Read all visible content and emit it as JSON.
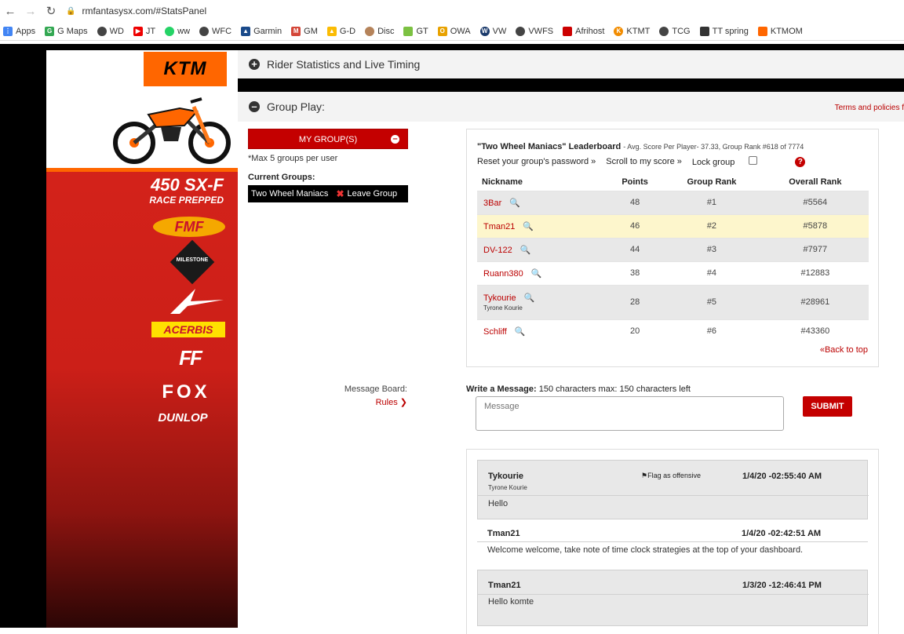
{
  "browser": {
    "url": "rmfantasysx.com/#StatsPanel",
    "bookmarks": [
      "Apps",
      "G Maps",
      "WD",
      "JT",
      "ww",
      "WFC",
      "Garmin",
      "GM",
      "G-D",
      "Disc",
      "GT",
      "OWA",
      "VW",
      "VWFS",
      "Afrihost",
      "KTMT",
      "TCG",
      "TT spring",
      "KTMOM"
    ]
  },
  "sidebar": {
    "brand": "KTM",
    "model": "450 SX-F",
    "model_sub": "RACE PREPPED",
    "sponsors": {
      "fmf": "FMF",
      "milestone": "MILESTONE",
      "acerbis": "ACERBIS",
      "fly": "FF",
      "fox": "FOX",
      "dunlop": "DUNLOP"
    }
  },
  "panels": {
    "rider_stats": "Rider Statistics and Live Timing",
    "group_play": "Group Play:",
    "terms": "Terms and policies f"
  },
  "groups": {
    "my_groups_label": "MY GROUP(S)",
    "max_note": "*Max 5 groups per user",
    "current_label": "Current Groups:",
    "current_group": "Two Wheel Maniacs",
    "leave_label": "Leave Group"
  },
  "leaderboard": {
    "title": "\"Two Wheel Maniacs\" Leaderboard",
    "subtitle": "- Avg. Score Per Player- 37.33, Group Rank #618 of 7774",
    "reset_link": "Reset your group's password »",
    "scroll_link": "Scroll to my score »",
    "lock_label": "Lock group",
    "columns": [
      "Nickname",
      "Points",
      "Group Rank",
      "Overall Rank"
    ],
    "rows": [
      {
        "nickname": "3Bar",
        "realname": "",
        "points": "48",
        "group_rank": "#1",
        "overall_rank": "#5564"
      },
      {
        "nickname": "Tman21",
        "realname": "",
        "points": "46",
        "group_rank": "#2",
        "overall_rank": "#5878"
      },
      {
        "nickname": "DV-122",
        "realname": "",
        "points": "44",
        "group_rank": "#3",
        "overall_rank": "#7977"
      },
      {
        "nickname": "Ruann380",
        "realname": "",
        "points": "38",
        "group_rank": "#4",
        "overall_rank": "#12883"
      },
      {
        "nickname": "Tykourie",
        "realname": "Tyrone Kourie",
        "points": "28",
        "group_rank": "#5",
        "overall_rank": "#28961"
      },
      {
        "nickname": "Schliff",
        "realname": "",
        "points": "20",
        "group_rank": "#6",
        "overall_rank": "#43360"
      }
    ],
    "back_to_top": "«Back to top"
  },
  "message_board": {
    "label": "Message Board:",
    "rules": "Rules",
    "write_label": "Write a Message:",
    "char_note": "150 characters max: 150 characters left",
    "placeholder": "Message",
    "submit": "SUBMIT",
    "messages": [
      {
        "author": "Tykourie",
        "realname": "Tyrone Kourie",
        "flag": "Flag as offensive",
        "time": "1/4/20 -02:55:40 AM",
        "body": "Hello"
      },
      {
        "author": "Tman21",
        "realname": "",
        "flag": "",
        "time": "1/4/20 -02:42:51 AM",
        "body": "Welcome welcome, take note of time clock strategies at the top of your dashboard."
      },
      {
        "author": "Tman21",
        "realname": "",
        "flag": "",
        "time": "1/3/20 -12:46:41 PM",
        "body": "Hello komte"
      }
    ]
  },
  "colors": {
    "accent_red": "#c40000",
    "ktm_orange": "#ff6600",
    "highlight_row": "#fdf6cc"
  }
}
